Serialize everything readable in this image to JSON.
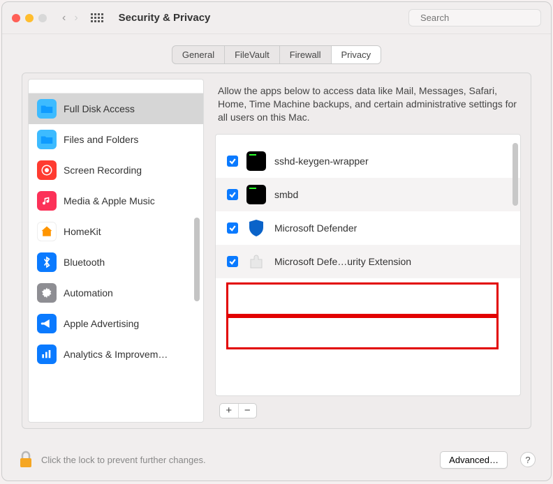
{
  "window": {
    "title": "Security & Privacy"
  },
  "search": {
    "placeholder": "Search"
  },
  "tabs": [
    {
      "label": "General",
      "active": false
    },
    {
      "label": "FileVault",
      "active": false
    },
    {
      "label": "Firewall",
      "active": false
    },
    {
      "label": "Privacy",
      "active": true
    }
  ],
  "sidebar": {
    "items": [
      {
        "label": "Full Disk Access",
        "selected": true,
        "icon": "folder-blue"
      },
      {
        "label": "Files and Folders",
        "selected": false,
        "icon": "folder-blue"
      },
      {
        "label": "Screen Recording",
        "selected": false,
        "icon": "record-red"
      },
      {
        "label": "Media & Apple Music",
        "selected": false,
        "icon": "music-pink"
      },
      {
        "label": "HomeKit",
        "selected": false,
        "icon": "home-orange"
      },
      {
        "label": "Bluetooth",
        "selected": false,
        "icon": "bluetooth-blue"
      },
      {
        "label": "Automation",
        "selected": false,
        "icon": "gear-gray"
      },
      {
        "label": "Apple Advertising",
        "selected": false,
        "icon": "megaphone-blue"
      },
      {
        "label": "Analytics & Improvem…",
        "selected": false,
        "icon": "chart-blue"
      }
    ]
  },
  "content": {
    "description": "Allow the apps below to access data like Mail, Messages, Safari, Home, Time Machine backups, and certain administrative settings for all users on this Mac.",
    "apps": [
      {
        "label": "sshd-keygen-wrapper",
        "checked": true,
        "icon": "terminal",
        "highlighted": false
      },
      {
        "label": "smbd",
        "checked": true,
        "icon": "terminal",
        "highlighted": false
      },
      {
        "label": "Microsoft Defender",
        "checked": true,
        "icon": "shield-blue",
        "highlighted": true
      },
      {
        "label": "Microsoft Defe…urity Extension",
        "checked": true,
        "icon": "extension-white",
        "highlighted": true
      }
    ]
  },
  "footer": {
    "lock_text": "Click the lock to prevent further changes.",
    "advanced": "Advanced…",
    "help": "?"
  }
}
